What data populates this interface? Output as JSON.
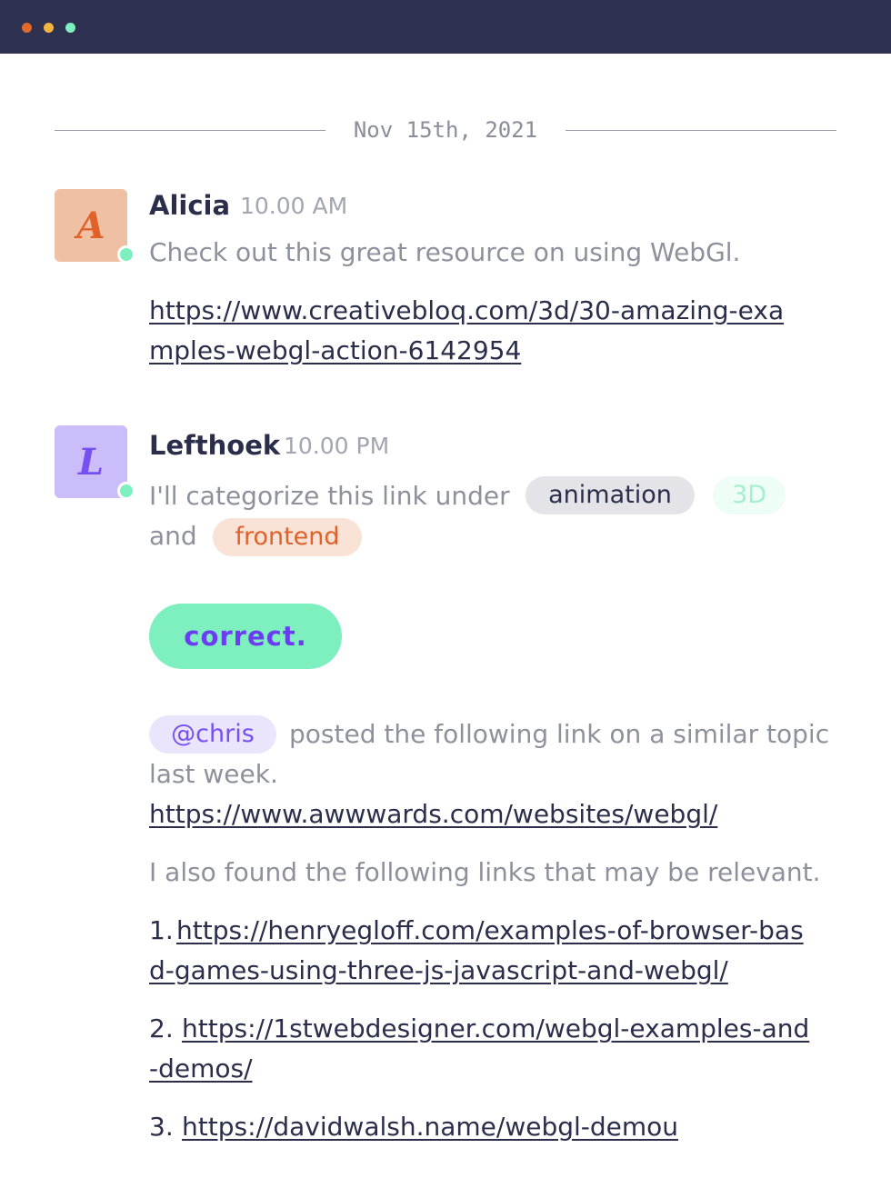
{
  "window": {
    "controls": [
      "close",
      "minimize",
      "maximize"
    ],
    "colors": {
      "close": "#e06a2b",
      "minimize": "#f2b544",
      "maximize": "#7ef0c0"
    }
  },
  "date_divider": "Nov 15th, 2021",
  "messages": [
    {
      "avatar_letter": "A",
      "avatar_bg": "#f0c0a4",
      "avatar_color": "#e0622a",
      "author": "Alicia",
      "time": "10.00 AM",
      "text": "Check out this great resource on using WebGl.",
      "link_line1": "https://www.creativebloq.com/3d/30-amazing-exa",
      "link_line2": "mples-webgl-action-6142954"
    },
    {
      "avatar_letter": "L",
      "avatar_bg": "#cbbcfa",
      "avatar_color": "#7650f0",
      "author": "Lefthoek",
      "time": "10.00 PM",
      "text_before": "I'll categorize this link under",
      "text_and": "and",
      "tags": [
        {
          "label": "animation",
          "bg": "#e3e3e8",
          "color": "#2b2e4a"
        },
        {
          "label": "3D",
          "bg": "#eefdf6",
          "color": "#a5efd0"
        },
        {
          "label": "frontend",
          "bg": "#f9e2d6",
          "color": "#e0622a"
        }
      ]
    }
  ],
  "button": {
    "label": "correct."
  },
  "mention": {
    "handle": "@chris",
    "text_line1": "posted the following link on a similar topic",
    "text_line2": "last week.",
    "link": "https://www.awwwards.com/websites/webgl/"
  },
  "related": {
    "intro": "I also found the following links that may be relevant.",
    "items": [
      {
        "num": "1.",
        "line1": "https://henryegloff.com/examples-of-browser-bas",
        "line2": "d-games-using-three-js-javascript-and-webgl/"
      },
      {
        "num": "2.",
        "line1": "https://1stwebdesigner.com/webgl-examples-and",
        "line2": "-demos/"
      },
      {
        "num": "3.",
        "line1": "https://davidwalsh.name/webgl-demou",
        "line2": ""
      }
    ]
  }
}
